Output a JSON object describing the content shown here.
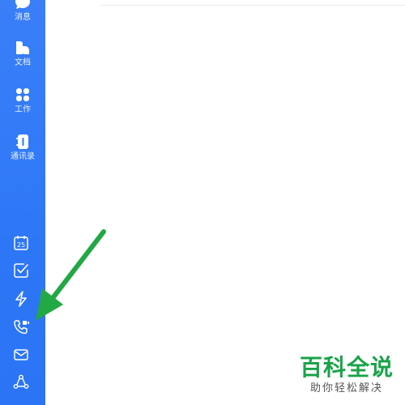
{
  "sidebar": {
    "items": [
      {
        "label": "消息",
        "icon": "chat-bubble-icon"
      },
      {
        "label": "文档",
        "icon": "document-folder-icon"
      },
      {
        "label": "工作",
        "icon": "apps-grid-icon"
      },
      {
        "label": "通讯录",
        "icon": "contacts-book-icon"
      }
    ],
    "tools": [
      {
        "icon": "calendar-icon",
        "text": "25"
      },
      {
        "icon": "checkbox-icon"
      },
      {
        "icon": "lightning-icon"
      },
      {
        "icon": "video-call-icon"
      },
      {
        "icon": "mail-icon"
      },
      {
        "icon": "share-network-icon"
      }
    ]
  },
  "colors": {
    "sidebar": "#2d77f7",
    "arrow": "#22a845",
    "watermark": "#1aa34a"
  },
  "watermark": {
    "title": "百科全说",
    "subtitle": "助你轻松解决"
  }
}
